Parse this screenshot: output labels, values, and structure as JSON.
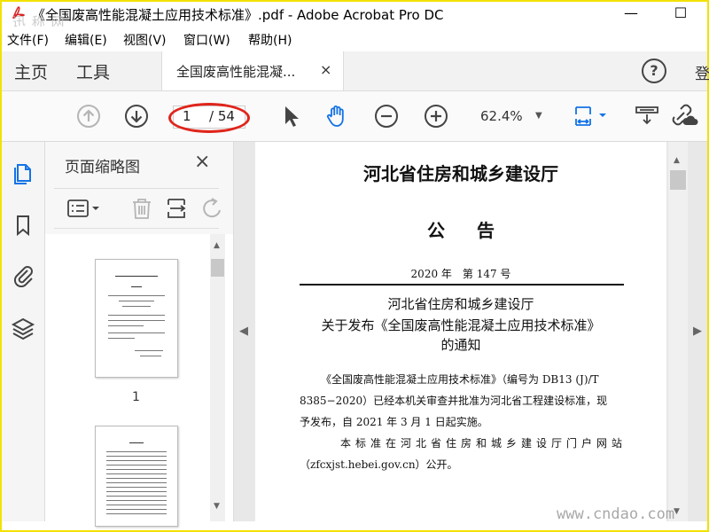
{
  "window": {
    "title": "《全国废高性能混凝土应用技术标准》.pdf - Adobe Acrobat Pro DC",
    "minimize": "—",
    "maximize": "☐",
    "watermark_tl": "迅 称 网"
  },
  "menu": [
    "文件(F)",
    "编辑(E)",
    "视图(V)",
    "窗口(W)",
    "帮助(H)"
  ],
  "tabs": {
    "home": "主页",
    "tools": "工具",
    "document": "全国废高性能混凝...",
    "close": "×",
    "help": "?",
    "login": "登"
  },
  "toolbar": {
    "current_page": "1",
    "total_pages": "/ 54",
    "zoom": "62.4%",
    "icons": [
      "arrow-up-circle-icon",
      "arrow-down-circle-icon",
      "select-cursor-icon",
      "hand-icon",
      "zoom-out-icon",
      "zoom-in-icon",
      "fit-page-icon",
      "scroll-mode-icon",
      "link-icon"
    ]
  },
  "annotation_color": "#e0251b",
  "accent_color": "#1473e6",
  "panel": {
    "title": "页面缩略图",
    "close": "×",
    "thumbnails": [
      {
        "num": "1"
      },
      {
        "num": ""
      }
    ]
  },
  "document": {
    "heading": "河北省住房和城乡建设厅",
    "notice": "公告",
    "number": "2020 年　第 147 号",
    "sub1": "河北省住房和城乡建设厅",
    "sub2": "关于发布《全国废高性能混凝土应用技术标准》",
    "sub3": "的通知",
    "para1_l1": "《全国废高性能混凝土应用技术标准》（编号为 DB13 (J)/T",
    "para1_l2": "8385−2020）已经本机关审查并批准为河北省工程建设标准，现",
    "para1_l3": "予发布，自 2021 年 3 月 1 日起实施。",
    "para2_l1": "本标准在河北省住房和城乡建设厅门户网站",
    "para2_l2": "（zfcxjst.hebei.gov.cn）公开。"
  },
  "watermark_br": "www.cndao.com"
}
